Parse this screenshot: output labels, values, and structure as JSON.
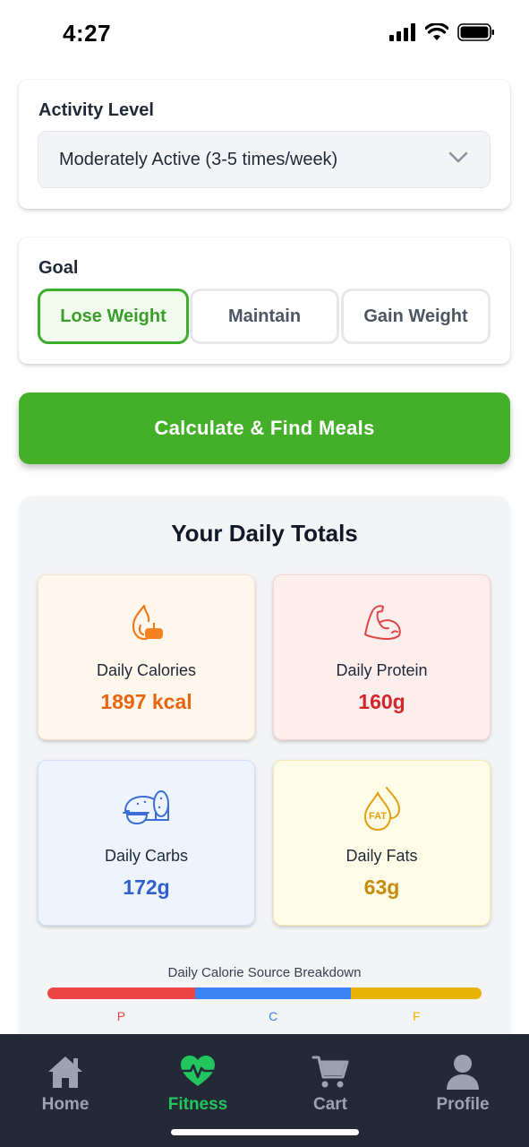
{
  "status_bar": {
    "time": "4:27"
  },
  "activity": {
    "title": "Activity Level",
    "selected": "Moderately Active (3-5 times/week)"
  },
  "goal": {
    "title": "Goal",
    "options": [
      {
        "label": "Lose Weight",
        "selected": true
      },
      {
        "label": "Maintain",
        "selected": false
      },
      {
        "label": "Gain Weight",
        "selected": false
      }
    ]
  },
  "calculate_button": {
    "label": "Calculate & Find Meals"
  },
  "totals": {
    "title": "Your Daily Totals",
    "cards": [
      {
        "label": "Daily Calories",
        "value": "1897 kcal",
        "icon": "flame-icon",
        "color": "#e8650f"
      },
      {
        "label": "Daily Protein",
        "value": "160g",
        "icon": "bicep-icon",
        "color": "#d4262a"
      },
      {
        "label": "Daily Carbs",
        "value": "172g",
        "icon": "bread-icon",
        "color": "#2f5fcf"
      },
      {
        "label": "Daily Fats",
        "value": "63g",
        "icon": "fat-drop-icon",
        "color": "#c48c0a"
      }
    ],
    "breakdown": {
      "title": "Daily Calorie Source Breakdown",
      "segments": [
        {
          "letter": "P",
          "fraction": 0.34,
          "color": "#ef4444"
        },
        {
          "letter": "C",
          "fraction": 0.36,
          "color": "#3b82f6"
        },
        {
          "letter": "F",
          "fraction": 0.3,
          "color": "#eab308"
        }
      ]
    }
  },
  "nav": {
    "items": [
      {
        "label": "Home",
        "icon": "home-icon",
        "active": false
      },
      {
        "label": "Fitness",
        "icon": "heart-pulse-icon",
        "active": true
      },
      {
        "label": "Cart",
        "icon": "cart-icon",
        "active": false
      },
      {
        "label": "Profile",
        "icon": "profile-icon",
        "active": false
      }
    ]
  },
  "colors": {
    "accent": "#44b02a",
    "nav_bg": "#232a36",
    "nav_active": "#22c55e"
  }
}
